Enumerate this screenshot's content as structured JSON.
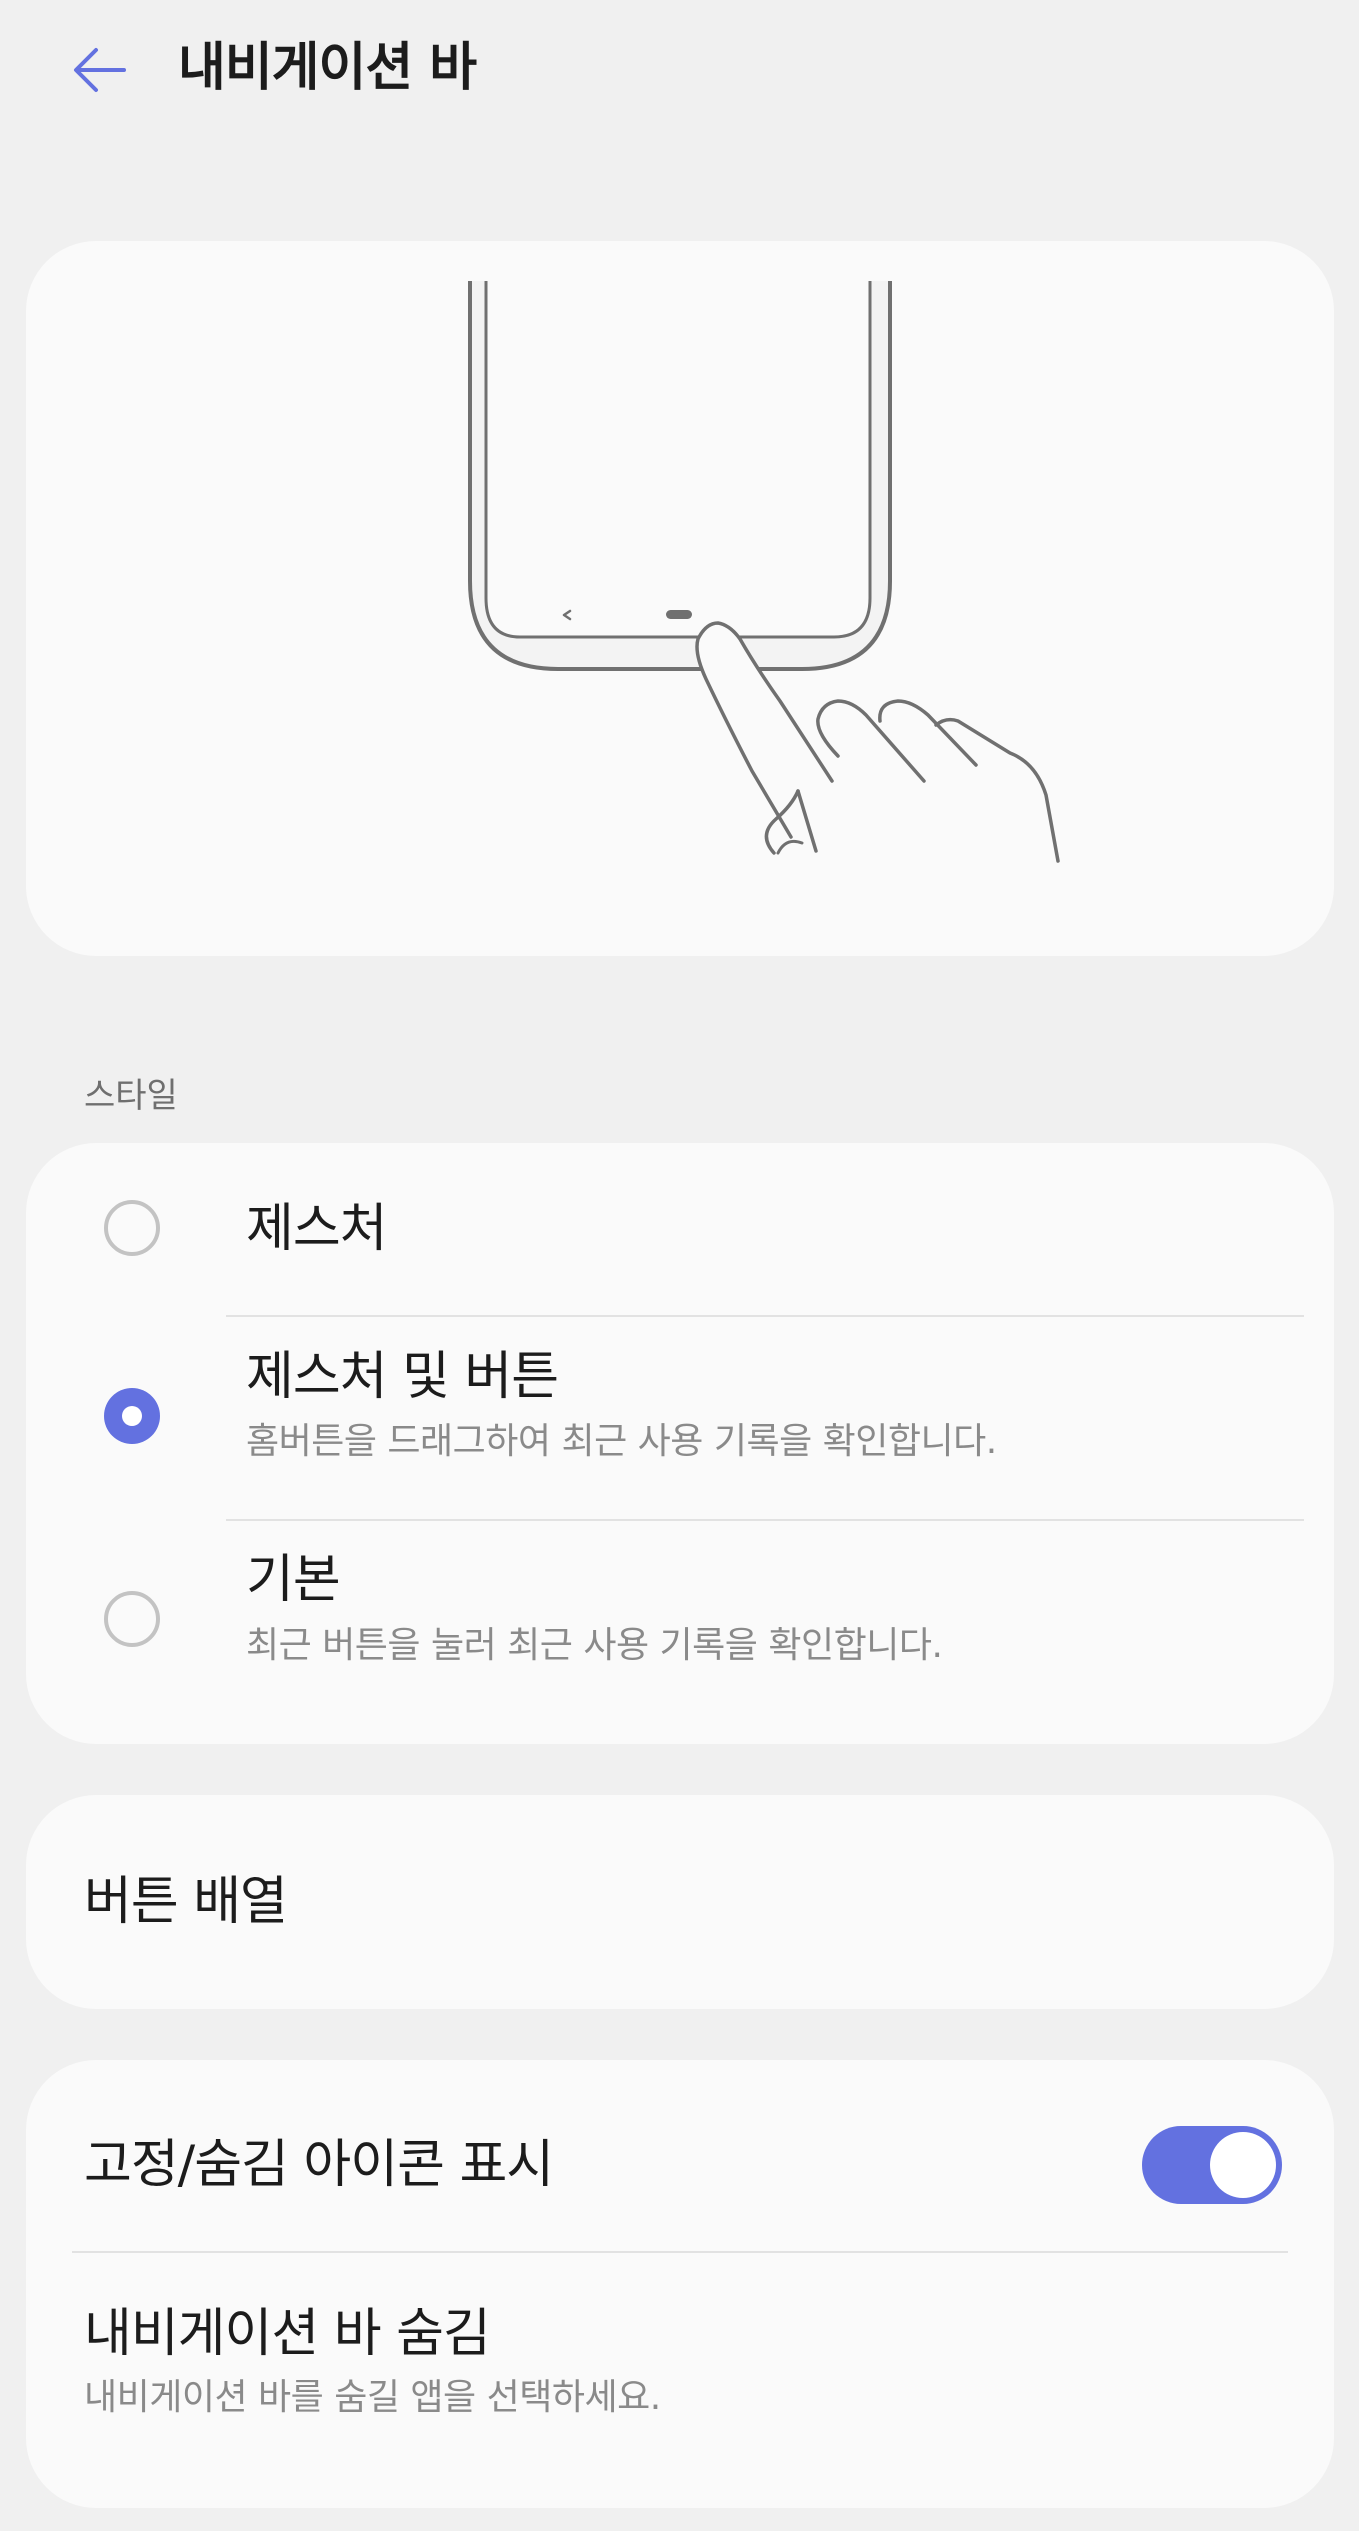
{
  "header": {
    "title": "내비게이션 바",
    "back_icon": "arrow-left-icon"
  },
  "style_section": {
    "label": "스타일",
    "options": [
      {
        "title": "제스처",
        "description": "",
        "selected": false
      },
      {
        "title": "제스처 및 버튼",
        "description": "홈버튼을 드래그하여 최근 사용 기록을 확인합니다.",
        "selected": true
      },
      {
        "title": "기본",
        "description": "최근 버튼을 눌러 최근 사용 기록을 확인합니다.",
        "selected": false
      }
    ]
  },
  "button_order": {
    "label": "버튼 배열"
  },
  "show_pin_hide_icon": {
    "label": "고정/숨김 아이콘 표시",
    "enabled": true
  },
  "hide_nav_bar": {
    "title": "내비게이션 바 숨김",
    "description": "내비게이션 바를 숨길 앱을 선택하세요."
  },
  "colors": {
    "accent": "#6371e0",
    "background": "#f0f0f0",
    "card": "#fafafa"
  }
}
